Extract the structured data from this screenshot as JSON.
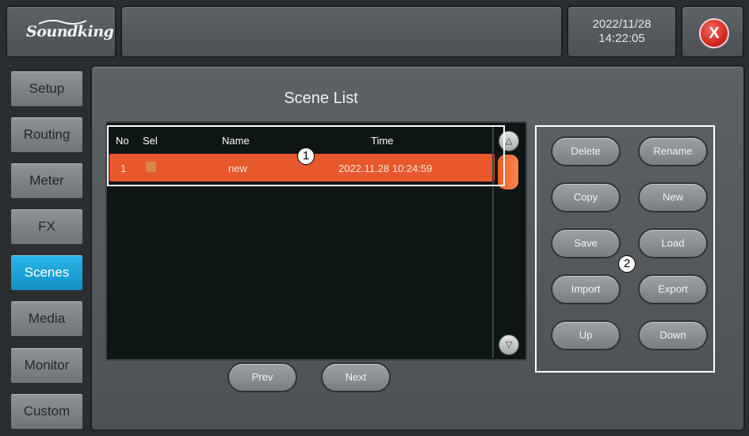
{
  "brand": {
    "logo_text": "Soundking"
  },
  "clock": {
    "date": "2022/11/28",
    "time": "14:22:05"
  },
  "close": {
    "label": "X"
  },
  "sidebar": {
    "items": [
      {
        "label": "Setup"
      },
      {
        "label": "Routing"
      },
      {
        "label": "Meter"
      },
      {
        "label": "FX"
      },
      {
        "label": "Scenes",
        "active": true
      },
      {
        "label": "Media"
      },
      {
        "label": "Monitor"
      },
      {
        "label": "Custom"
      }
    ]
  },
  "scene_list": {
    "title": "Scene List",
    "columns": {
      "no": "No",
      "sel": "Sel",
      "name": "Name",
      "time": "Time"
    },
    "rows": [
      {
        "no": "1",
        "name": "new",
        "time": "2022.11.28 10:24:59",
        "selected_color": "#d7884a"
      }
    ],
    "scroll_up_icon": "triangle-up",
    "scroll_down_icon": "triangle-down"
  },
  "pager": {
    "prev": "Prev",
    "next": "Next"
  },
  "actions": {
    "delete": "Delete",
    "rename": "Rename",
    "copy": "Copy",
    "new": "New",
    "save": "Save",
    "load": "Load",
    "import": "Import",
    "export": "Export",
    "up": "Up",
    "down": "Down"
  },
  "callouts": {
    "one": "1",
    "two": "2"
  },
  "colors": {
    "accent": "#e8582d",
    "active_tab": "#1aa3d8",
    "close": "#d22a22"
  }
}
